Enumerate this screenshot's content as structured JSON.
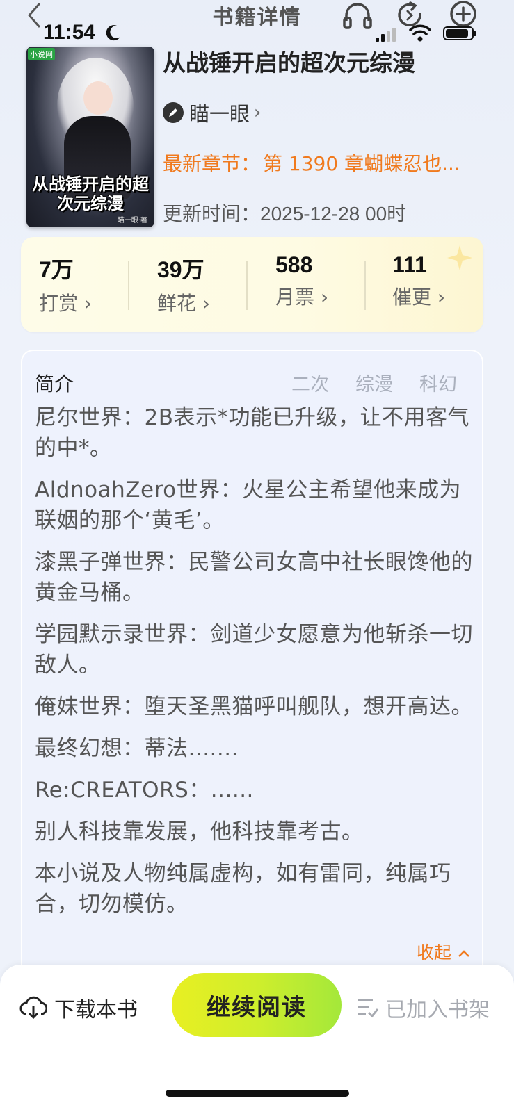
{
  "status": {
    "time": "11:54"
  },
  "nav": {
    "title": "书籍详情",
    "icons": [
      "back-icon",
      "headphones-icon",
      "refresh-icon",
      "add-circle-icon"
    ]
  },
  "book": {
    "cover_title": "从战锤开启的超次元综漫",
    "cover_badge": "小说网",
    "cover_author": "瞄一眼·著",
    "title": "从战锤开启的超次元综漫",
    "author": "瞄一眼",
    "latest_label": "最新章节：",
    "latest_chapter": "第 1390 章蝴蝶忍也...",
    "updated_label": "更新时间：",
    "updated_value": "2025-12-28 00时"
  },
  "stats": [
    {
      "num": "7万",
      "label": "打赏"
    },
    {
      "num": "39万",
      "label": "鲜花"
    },
    {
      "num": "588",
      "label": "月票"
    },
    {
      "num": "111",
      "label": "催更"
    }
  ],
  "intro": {
    "heading": "简介",
    "tags": [
      "二次",
      "综漫",
      "科幻"
    ],
    "paragraphs": [
      "尼尔世界：2B表示*功能已升级，让不用客气的中*。",
      "AldnoahZero世界：火星公主希望他来成为联姻的那个‘黄毛’。",
      "漆黑子弹世界：民警公司女高中社长眼馋他的黄金马桶。",
      "学园默示录世界：剑道少女愿意为他斩杀一切敌人。",
      "俺妹世界：堕天圣黑猫呼叫舰队，想开高达。",
      "最终幻想：蒂法.......",
      "Re:CREATORS：......",
      "别人科技靠发展，他科技靠考古。",
      "本小说及人物纯属虚构，如有雷同，纯属巧合，切勿模仿。"
    ],
    "collapse": "收起"
  },
  "bottom": {
    "download": "下载本书",
    "read": "继续阅读",
    "shelf": "已加入书架"
  },
  "colors": {
    "accent_orange": "#f07a1e",
    "read_button_start": "#e8ef22",
    "read_button_end": "#a4e83a"
  }
}
